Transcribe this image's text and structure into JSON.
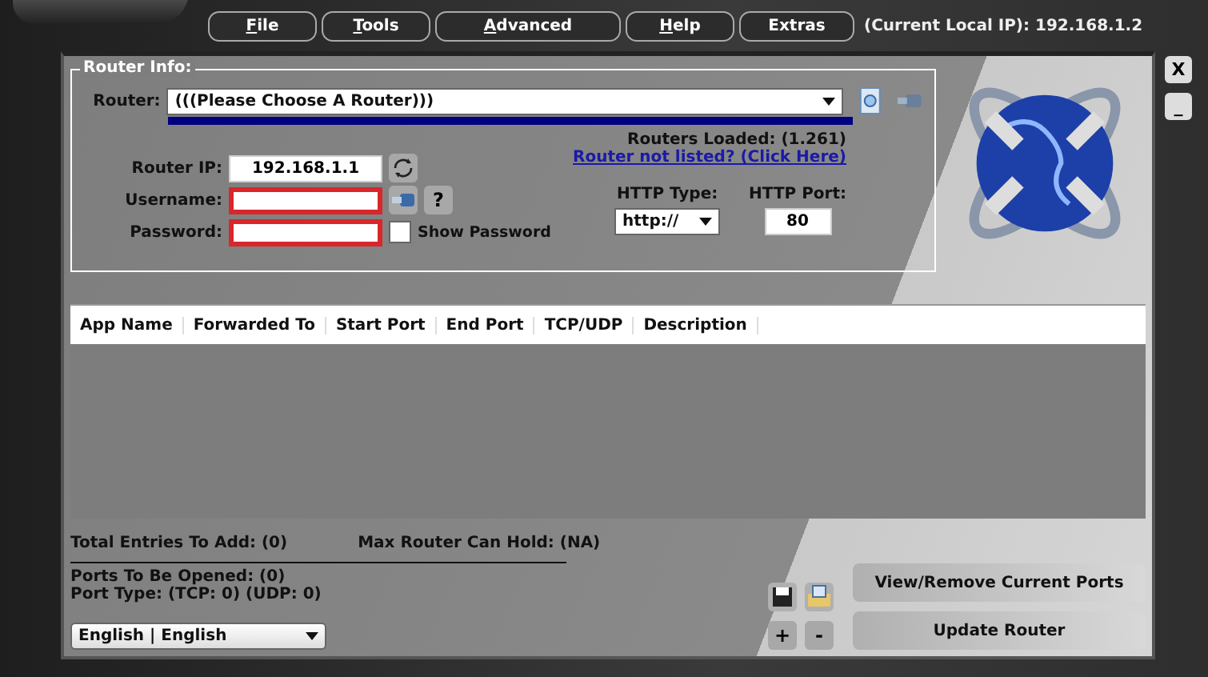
{
  "menu": [
    {
      "accel": "F",
      "rest": "ile"
    },
    {
      "accel": "T",
      "rest": "ools"
    },
    {
      "accel": "A",
      "rest": "dvanced"
    },
    {
      "accel": "H",
      "rest": "elp"
    },
    {
      "rest": "Extras"
    }
  ],
  "local_ip": "(Current Local IP): 192.168.1.2",
  "window_buttons": [
    "X",
    "_"
  ],
  "router_info": {
    "title": "Router Info:",
    "router_label": "Router:",
    "router_value": "(((Please Choose A Router)))",
    "routers_loaded": "Routers Loaded: (1.261)",
    "not_listed_link": "Router not listed? (Click Here)",
    "ip_label": "Router IP:",
    "ip_value": "192.168.1.1",
    "username_label": "Username:",
    "password_label": "Password:",
    "help_button": "?",
    "show_password": {
      "label": "Show Password",
      "checked": false
    },
    "http_type_label": "HTTP Type:",
    "http_type_value": "http://",
    "http_port_label": "HTTP Port:",
    "http_port_value": "80"
  },
  "table": {
    "columns": [
      "App Name",
      "Forwarded To",
      "Start Port",
      "End Port",
      "TCP/UDP",
      "Description"
    ]
  },
  "summary": {
    "total_entries": "Total Entries To Add: (0)",
    "max_router": "Max Router Can Hold: (NA)",
    "ports_opened": "Ports To Be Opened: (0)",
    "port_type": "Port Type: (TCP: 0) (UDP: 0)"
  },
  "language": "English | English",
  "small_buttons": [
    "+",
    "-"
  ],
  "buttons": [
    "View/Remove Current Ports",
    "Update Router"
  ]
}
